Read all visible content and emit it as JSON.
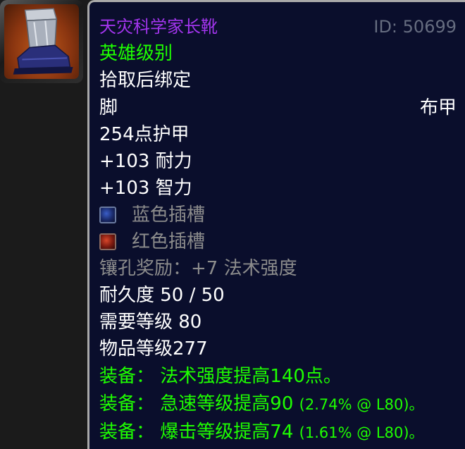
{
  "item": {
    "icon": "cloth-boots-icon",
    "name": "天灾科学家长靴",
    "id_text": "ID: 50699",
    "quality": "英雄级别",
    "bind": "拾取后绑定",
    "slot": "脚",
    "armor_type": "布甲",
    "armor": "254点护甲",
    "stats": [
      "+103 耐力",
      "+103 智力"
    ],
    "sockets": [
      {
        "color": "blue",
        "label": "蓝色插槽"
      },
      {
        "color": "red",
        "label": "红色插槽"
      }
    ],
    "socket_bonus": "镶孔奖励：+7 法术强度",
    "durability": "耐久度 50 / 50",
    "required_level": "需要等级 80",
    "item_level": "物品等级277",
    "equip_effects": [
      {
        "prefix": "装备：",
        "text": "法术强度提高140点。",
        "note": ""
      },
      {
        "prefix": "装备：",
        "text": "急速等级提高90",
        "note": "(2.74% @ L80)。"
      },
      {
        "prefix": "装备：",
        "text": "爆击等级提高74",
        "note": "(1.61% @ L80)。"
      }
    ]
  },
  "colors": {
    "epic_name": "#a335ee",
    "heroic_green": "#1eff00",
    "socket_bonus_gray": "#8c8c8c",
    "id_gray": "#666d80",
    "tooltip_bg": "#0a0e2c",
    "tooltip_border": "#a9a9a9"
  }
}
